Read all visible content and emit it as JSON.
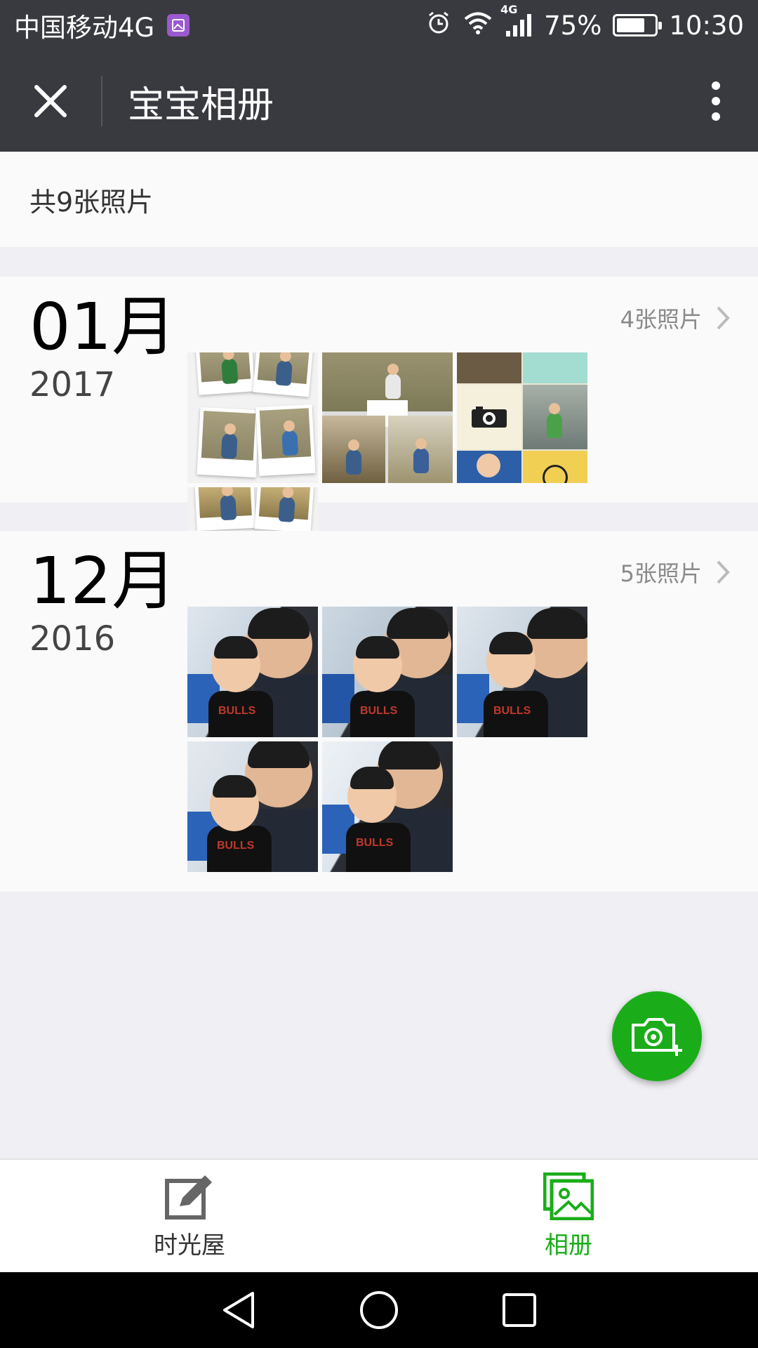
{
  "status_bar": {
    "carrier": "中国移动4G",
    "network_badge": "4G",
    "battery": "75%",
    "battery_level": 0.75,
    "time": "10:30"
  },
  "header": {
    "title": "宝宝相册",
    "close_icon": "close-icon",
    "more_icon": "more-vertical-icon"
  },
  "summary": {
    "total_label": "共9张照片"
  },
  "months": [
    {
      "month": "01月",
      "year": "2017",
      "count_label": "4张照片"
    },
    {
      "month": "12月",
      "year": "2016",
      "count_label": "5张照片"
    }
  ],
  "fab": {
    "icon": "camera-add-icon"
  },
  "tabs": [
    {
      "label": "时光屋",
      "icon": "edit-icon",
      "active": false
    },
    {
      "label": "相册",
      "icon": "album-icon",
      "active": true
    }
  ],
  "colors": {
    "header_bg": "#393a3f",
    "accent_green": "#1aad19",
    "page_bg": "#efeff4"
  }
}
